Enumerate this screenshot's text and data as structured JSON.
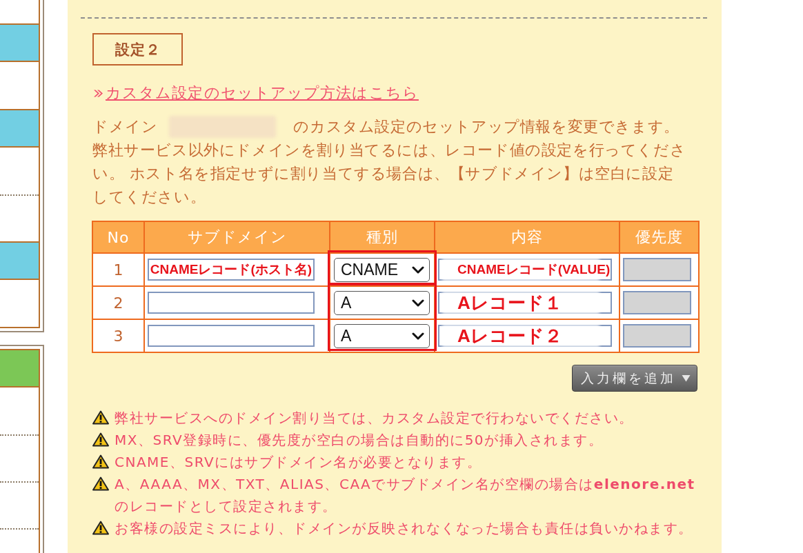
{
  "sidebar": {
    "panels": [
      {
        "items": [
          {
            "kind": "blank"
          },
          {
            "kind": "heading",
            "color": "#72cfe3"
          },
          {
            "kind": "blank"
          },
          {
            "kind": "heading",
            "color": "#72cfe3"
          },
          {
            "kind": "blank"
          },
          {
            "kind": "blank"
          },
          {
            "kind": "heading",
            "color": "#72cfe3"
          },
          {
            "kind": "blank"
          }
        ]
      },
      {
        "items": [
          {
            "kind": "heading",
            "color": "#7cc756"
          },
          {
            "kind": "blank"
          },
          {
            "kind": "blank"
          },
          {
            "kind": "blank"
          },
          {
            "kind": "blank"
          }
        ]
      }
    ]
  },
  "section": {
    "title": "設定２",
    "help_link": "カスタム設定のセットアップ方法はこちら",
    "intro": {
      "prefix": "ドメイン",
      "domain_blurred": true,
      "suffix": "のカスタム設定のセットアップ情報を変更できます。"
    },
    "instructions": "弊社サービス以外にドメインを割り当てるには、レコード値の設定を行ってください。 ホスト名を指定せずに割り当てする場合は、【サブドメイン】は空白に設定してください。"
  },
  "table": {
    "columns": [
      "No",
      "サブドメイン",
      "種別",
      "内容",
      "優先度"
    ],
    "row_groups": [
      {
        "type_highlighted": true,
        "rows": [
          {
            "no": "1",
            "subdomain_note": "CNAMEレコード(ホスト名)",
            "type": "CNAME",
            "content_blurred": true,
            "content_note": "CNAMEレコード(VALUE)",
            "priority_disabled": true
          }
        ]
      },
      {
        "type_highlighted": true,
        "rows": [
          {
            "no": "2",
            "type": "A",
            "content_blurred": true,
            "content_note": "Aレコード１",
            "priority_disabled": true
          },
          {
            "no": "3",
            "type": "A",
            "content_blurred": true,
            "content_note": "Aレコード２",
            "priority_disabled": true
          }
        ]
      }
    ]
  },
  "add_button": "入力欄を追加",
  "notes": [
    "弊社サービスへのドメイン割り当ては、カスタム設定で行わないでください。",
    "MX、SRV登録時に、優先度が空白の場合は自動的に50が挿入されます。",
    "CNAME、SRVにはサブドメイン名が必要となります。",
    "A、AAAA、MX、TXT、ALIAS、CAAでサブドメイン名が空欄の場合は**elenore.net**のレコードとして設定されます。",
    "お客様の設定ミスにより、ドメインが反映されなくなった場合も責任は負いかねます。"
  ]
}
